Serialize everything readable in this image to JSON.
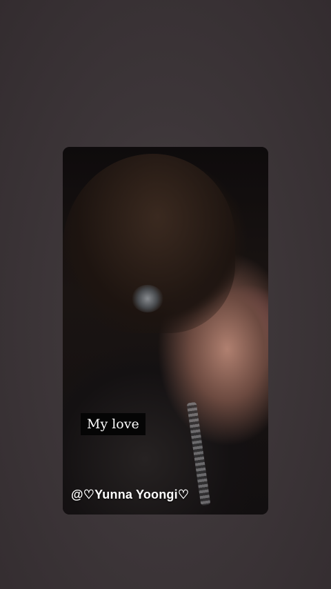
{
  "story": {
    "caption": "My love",
    "watermark": "@♡Yunna Yoongi♡"
  },
  "colors": {
    "background": "#3d3639",
    "caption_background": "#050505",
    "text": "#ffffff"
  }
}
